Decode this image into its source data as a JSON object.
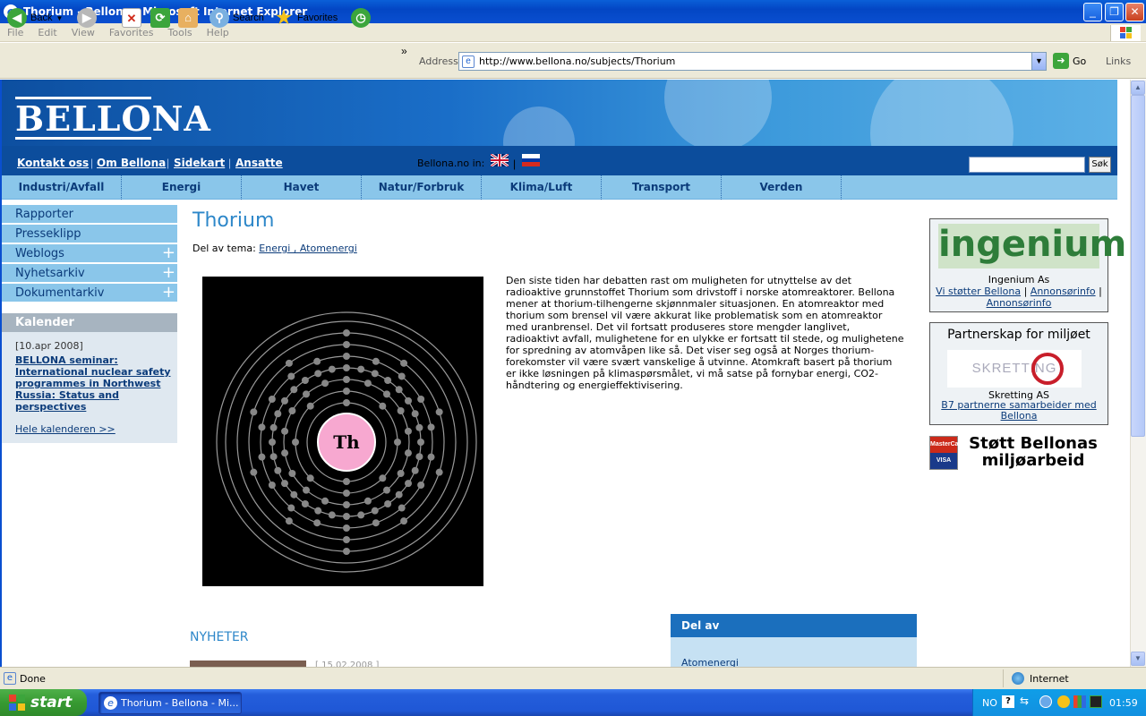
{
  "window": {
    "title": "Thorium - Bellona - Microsoft Internet Explorer",
    "min_glyph": "_",
    "max_glyph": "❐",
    "close_glyph": "✕"
  },
  "menu": [
    "File",
    "Edit",
    "View",
    "Favorites",
    "Tools",
    "Help"
  ],
  "toolbar": {
    "back_label": "Back",
    "search_label": "Search",
    "favorites_label": "Favorites",
    "overflow_glyph": "»",
    "address_label": "Address",
    "address_value": "http://www.bellona.no/subjects/Thorium",
    "go_label": "Go",
    "links_label": "Links"
  },
  "site": {
    "logo": "BELLONA",
    "top_links": [
      "Kontakt oss",
      "Om Bellona",
      "Sidekart",
      "Ansatte"
    ],
    "lang_label": "Bellona.no in:",
    "lang_sep": "|",
    "search_button": "Søk",
    "categories": [
      "Industri/Avfall",
      "Energi",
      "Havet",
      "Natur/Forbruk",
      "Klima/Luft",
      "Transport",
      "Verden"
    ]
  },
  "sidebar": {
    "items": [
      {
        "label": "Rapporter"
      },
      {
        "label": "Presseklipp"
      },
      {
        "label": "Weblogs"
      },
      {
        "label": "Nyhetsarkiv"
      },
      {
        "label": "Dokumentarkiv"
      }
    ],
    "plus_glyph": "+",
    "calendar_heading": "Kalender",
    "calendar_date": "[10.apr 2008]",
    "calendar_event": "BELLONA seminar: International nuclear safety programmes in Northwest Russia: Status and perspectives",
    "calendar_all": "Hele kalenderen >>"
  },
  "main": {
    "title": "Thorium",
    "theme_prefix": "Del av tema:",
    "theme_links": "Energi , Atomenergi",
    "atom_symbol": "Th",
    "article": "Den siste tiden har debatten rast om muligheten for utnyttelse av det radioaktive grunnstoffet Thorium som drivstoff i norske atomreaktorer. Bellona mener at thorium-tilhengerne skjønnmaler situasjonen. En atomreaktor med thorium som brensel vil være akkurat like problematisk som en atomreaktor med uranbrensel. Det vil fortsatt produseres store mengder langlivet, radioaktivt avfall, mulighetene for en ulykke er fortsatt til stede, og mulighetene for spredning av atomvåpen like så. Det viser seg også at Norges thorium-forekomster vil være svært vanskelige å utvinne. Atomkraft basert på thorium er ikke løsningen på klimaspørsmålet, vi må satse på fornybar energi, CO2-håndtering og energieffektivisering.",
    "news_heading": "NYHETER",
    "news_date": "[ 15.02.2008 ]",
    "delav_heading": "Del av",
    "delav_link": "Atomenergi"
  },
  "right": {
    "ingenium_logo": "ingenium",
    "ingenium_name": "Ingenium As",
    "ingenium_links": [
      "Vi støtter Bellona",
      "Annonsørinfo",
      "Annonsørinfo"
    ],
    "link_sep": "|",
    "partner_heading": "Partnerskap for miljøet",
    "skretting_logo": "SKRETTING",
    "skretting_name": "Skretting AS",
    "partners_link": "B7 partnerne samarbeider med Bellona",
    "card_top": "MasterCard",
    "card_bottom": "VISA",
    "support_text": "Støtt Bellonas miljøarbeid"
  },
  "status": {
    "text": "Done",
    "zone": "Internet"
  },
  "taskbar": {
    "start": "start",
    "task": "Thorium - Bellona - Mi...",
    "lang": "NO",
    "help_glyph": "?",
    "time": "01:59"
  }
}
